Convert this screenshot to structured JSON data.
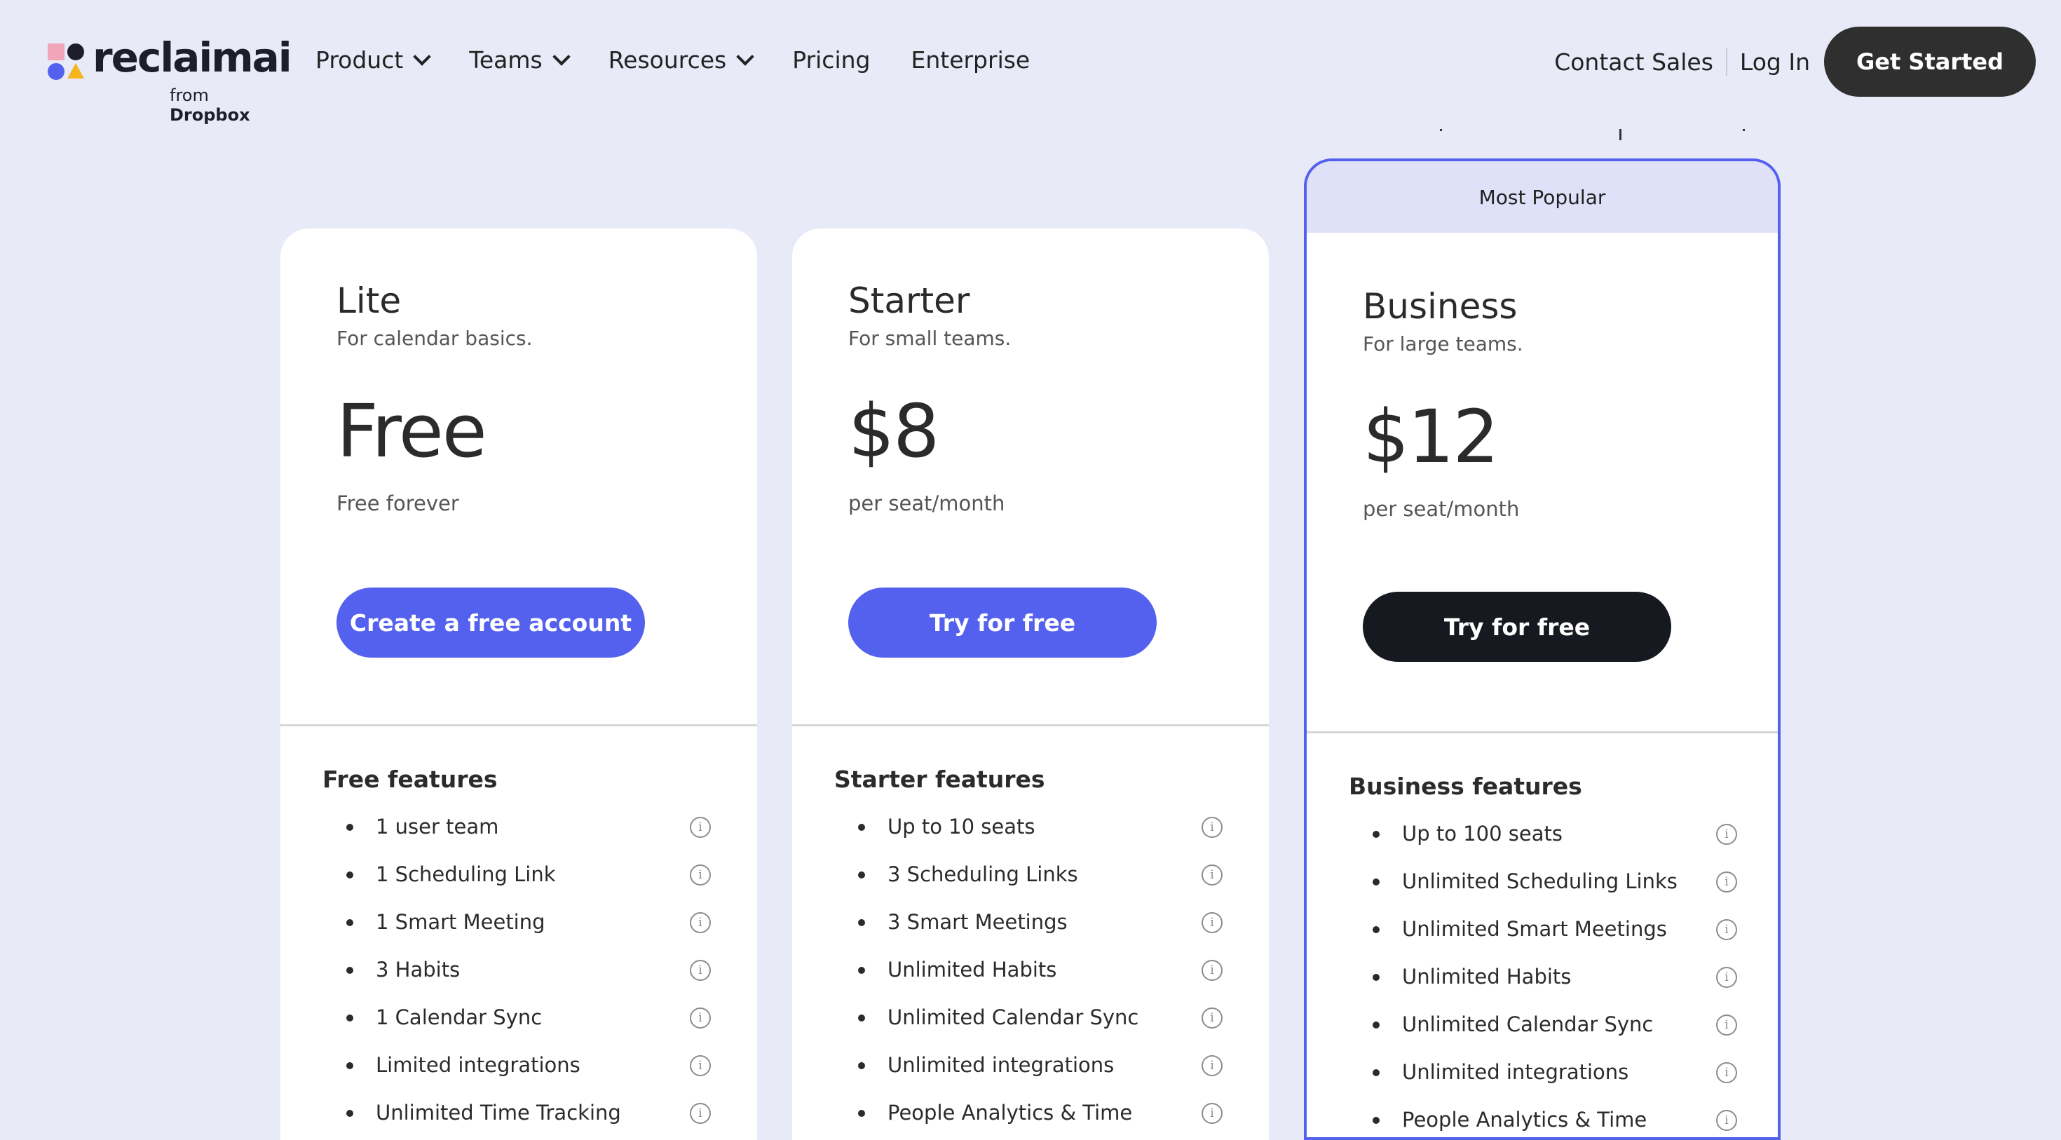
{
  "brand": {
    "wordmark": "reclaimai",
    "from_prefix": "from",
    "from_brand": "Dropbox"
  },
  "nav": {
    "items": [
      {
        "label": "Product",
        "icon": "chevron-down-icon"
      },
      {
        "label": "Teams",
        "icon": "chevron-down-icon"
      },
      {
        "label": "Resources",
        "icon": "chevron-down-icon"
      },
      {
        "label": "Pricing"
      },
      {
        "label": "Enterprise"
      }
    ],
    "contact_sales": "Contact Sales",
    "log_in": "Log In",
    "get_started": "Get Started"
  },
  "colors": {
    "page_bg": "#e8eaf8",
    "accent": "#5461ee",
    "dark": "#16191f",
    "popular_band": "#dfe1f9"
  },
  "plans": [
    {
      "name": "Lite",
      "tagline": "For calendar basics.",
      "price": "Free",
      "period": "Free forever",
      "cta": "Create a free account",
      "features_title": "Free features",
      "features": [
        "1 user team",
        "1 Scheduling Link",
        "1 Smart Meeting",
        "3 Habits",
        "1 Calendar Sync",
        "Limited integrations",
        "Unlimited Time Tracking"
      ]
    },
    {
      "name": "Starter",
      "tagline": "For small teams.",
      "price": "$8",
      "period": "per seat/month",
      "cta": "Try for free",
      "features_title": "Starter features",
      "features": [
        "Up to 10 seats",
        "3 Scheduling Links",
        "3 Smart Meetings",
        "Unlimited Habits",
        "Unlimited Calendar Sync",
        "Unlimited integrations",
        "People Analytics & Time"
      ]
    },
    {
      "badge": "Most Popular",
      "name": "Business",
      "tagline": "For large teams.",
      "price": "$12",
      "period": "per seat/month",
      "cta": "Try for free",
      "features_title": "Business features",
      "features": [
        "Up to 100 seats",
        "Unlimited Scheduling Links",
        "Unlimited Smart Meetings",
        "Unlimited Habits",
        "Unlimited Calendar Sync",
        "Unlimited integrations",
        "People Analytics & Time"
      ]
    }
  ]
}
